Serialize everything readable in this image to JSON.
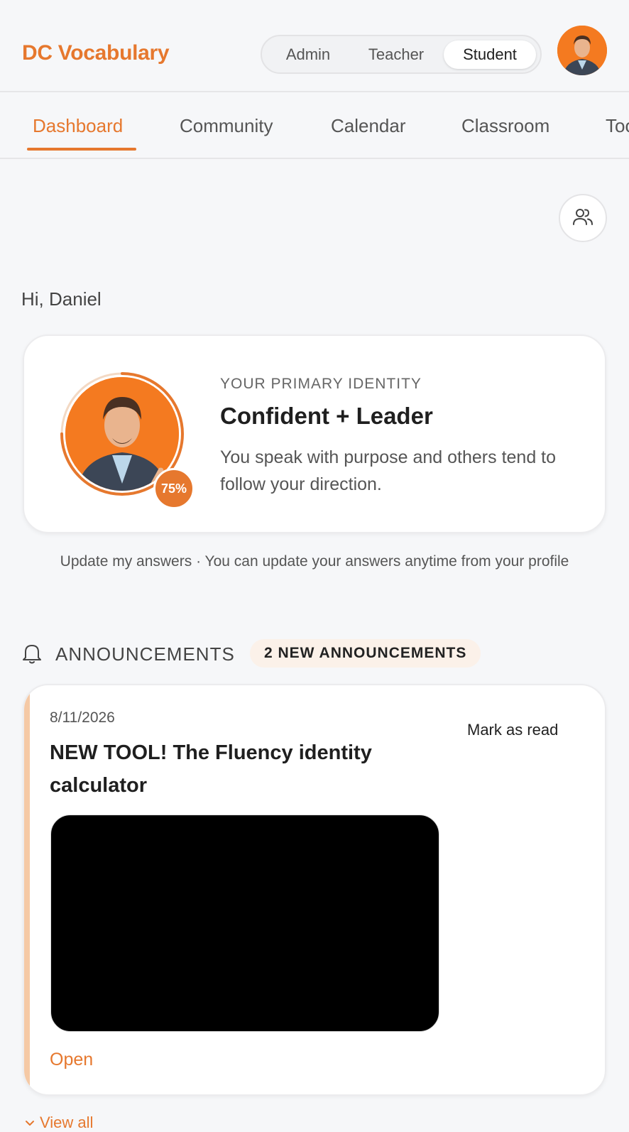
{
  "header": {
    "brand": "DC Vocabulary",
    "roles": [
      "Admin",
      "Teacher",
      "Student"
    ],
    "active_role": "Student",
    "avatar_icon": "user-avatar"
  },
  "tabs": {
    "items": [
      "Dashboard",
      "Community",
      "Calendar",
      "Classroom",
      "Too"
    ],
    "active": "Dashboard"
  },
  "greeting": "Hi, Daniel",
  "identity": {
    "eyebrow": "YOUR PRIMARY IDENTITY",
    "title": "Confident + Leader",
    "description": "You speak with purpose and others tend to follow your direction.",
    "progress_label": "75%",
    "progress_fraction": 0.75
  },
  "update_note": "Update my answers · You can update your answers anytime from your profile",
  "announcements": {
    "title": "ANNOUNCEMENTS",
    "new_badge": "2 NEW ANNOUNCEMENTS",
    "items": [
      {
        "date": "8/11/2026",
        "headline": "NEW TOOL! The Fluency identity calculator",
        "mark_read": "Mark as read",
        "open": "Open"
      }
    ],
    "view_all": "View all"
  },
  "colors": {
    "accent": "#e6782e",
    "photo_bg": "#f47a20",
    "background": "#f6f7f9"
  }
}
